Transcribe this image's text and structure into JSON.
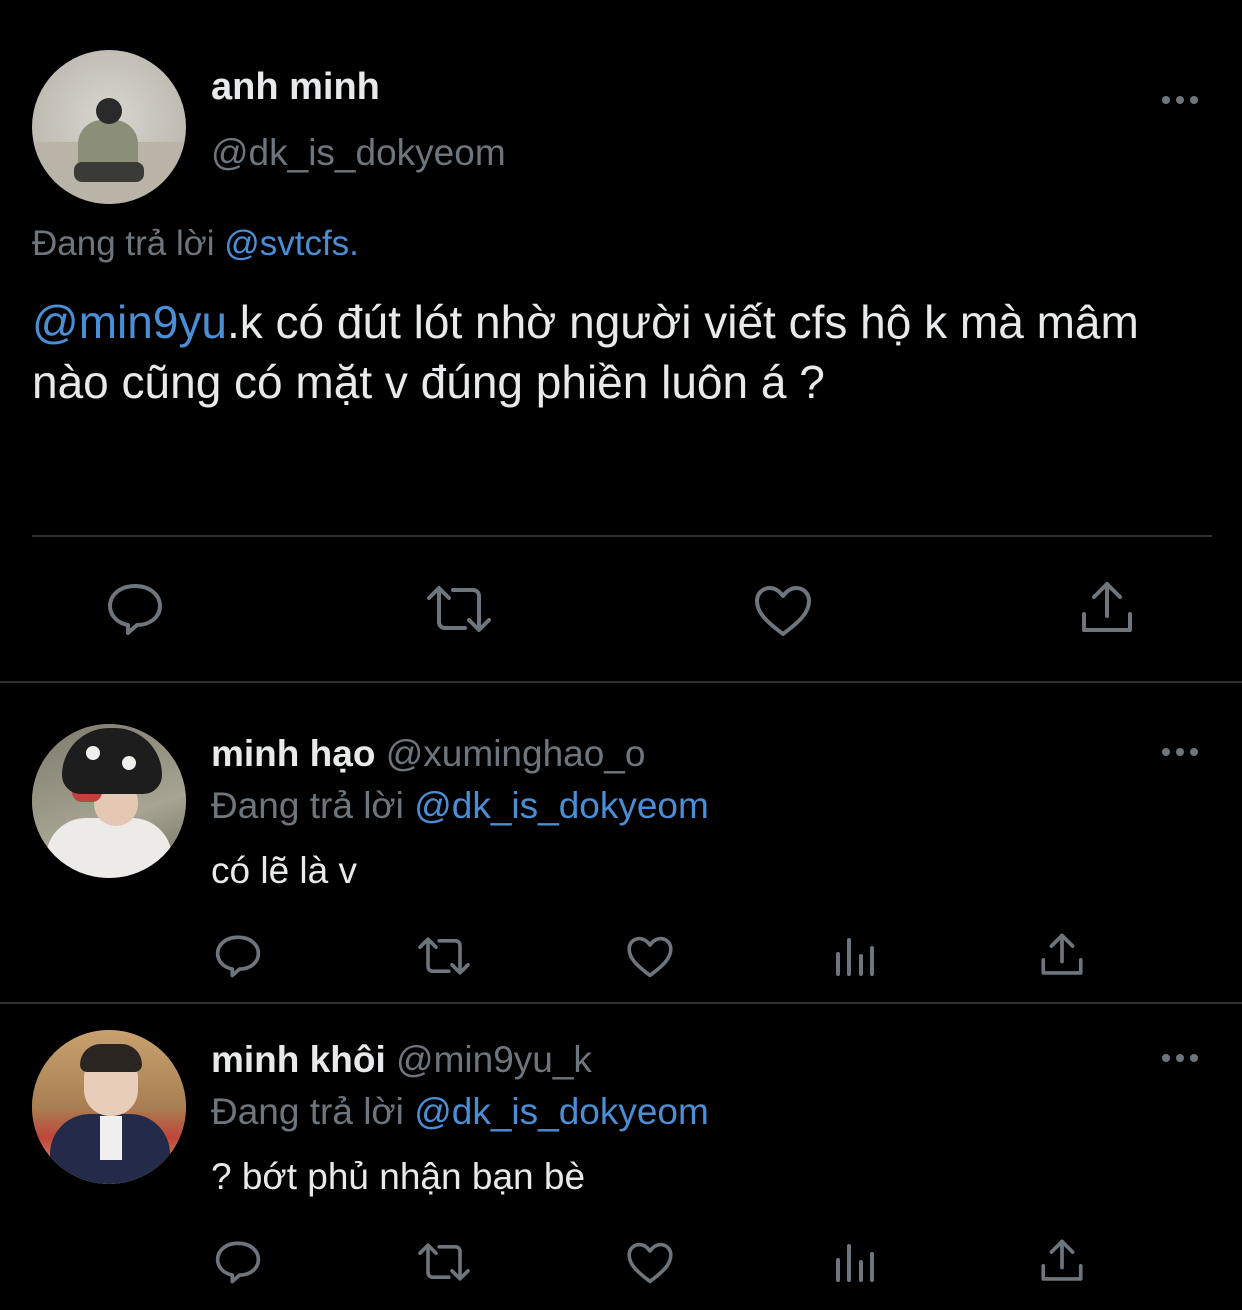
{
  "main_tweet": {
    "name": "anh minh",
    "handle": "@dk_is_dokyeom",
    "replying_prefix": "Đang trả lời",
    "replying_to": "@svtcfs.",
    "mention": "@min9yu",
    "text_rest": ".k có đút lót nhờ người viết cfs hộ k mà mâm nào cũng có mặt v đúng phiền luôn á ?",
    "actions": [
      "reply-icon",
      "retweet-icon",
      "like-icon",
      "share-icon"
    ]
  },
  "replies": [
    {
      "name": "minh hạo",
      "handle": "@xuminghao_o",
      "replying_prefix": "Đang trả lời",
      "replying_to": "@dk_is_dokyeom",
      "text": "có lẽ là v",
      "actions": [
        "reply-icon",
        "retweet-icon",
        "like-icon",
        "analytics-icon",
        "share-icon"
      ]
    },
    {
      "name": "minh khôi",
      "handle": "@min9yu_k",
      "replying_prefix": "Đang trả lời",
      "replying_to": "@dk_is_dokyeom",
      "text": "? bớt phủ nhận bạn bè",
      "actions": [
        "reply-icon",
        "retweet-icon",
        "like-icon",
        "analytics-icon",
        "share-icon"
      ]
    }
  ],
  "colors": {
    "background": "#000000",
    "text_primary": "#e7e9ea",
    "text_secondary": "#6e767d",
    "link": "#4a8ed6",
    "divider": "#2f3336"
  }
}
